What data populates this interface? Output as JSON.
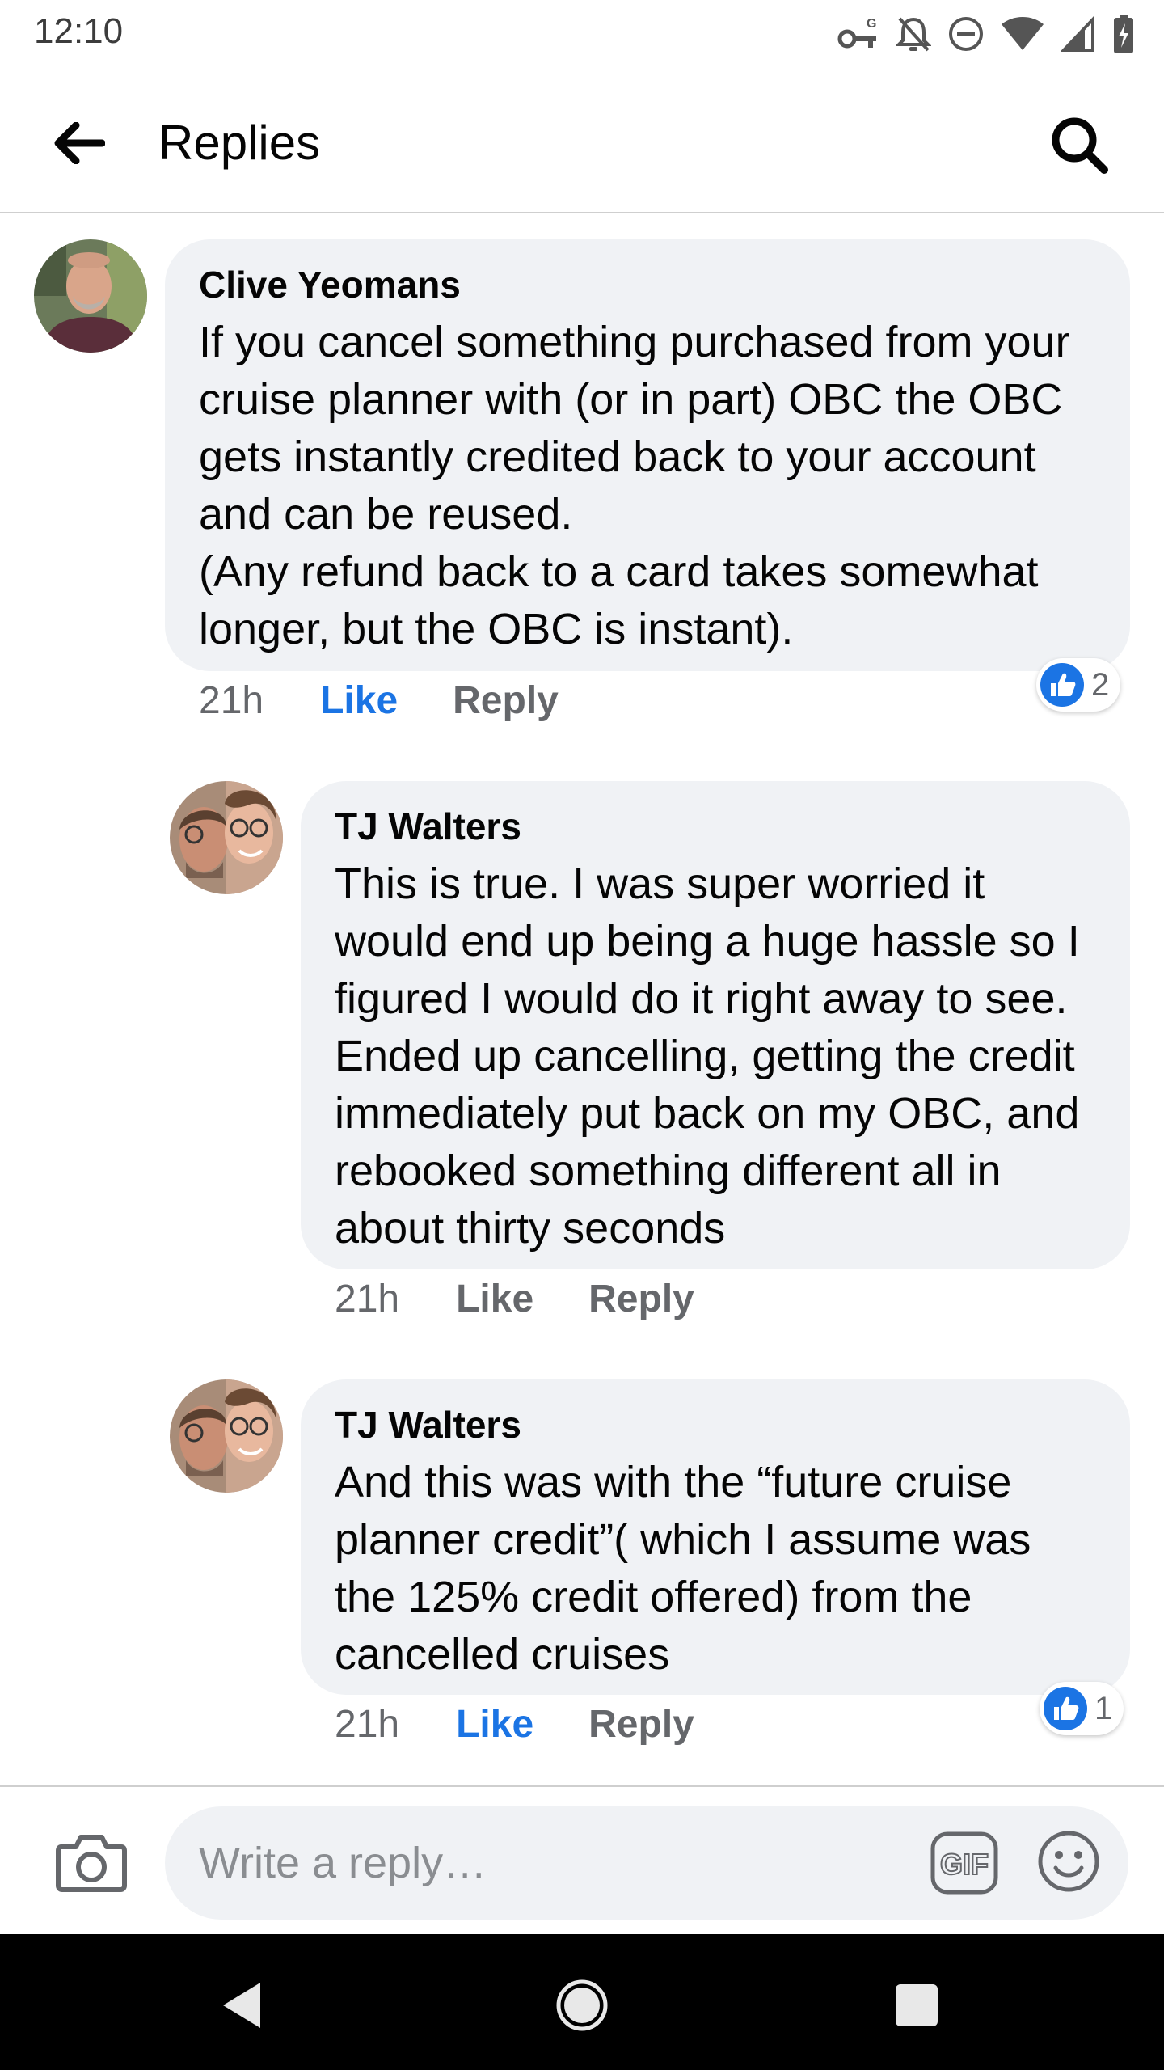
{
  "status_bar": {
    "time": "12:10"
  },
  "header": {
    "title": "Replies"
  },
  "comments": [
    {
      "author": "Clive Yeomans",
      "text": "If you cancel something purchased from your cruise planner with (or in part) OBC the OBC gets instantly credited back to your account and can be reused.\n(Any refund back to a card takes somewhat longer, but the OBC is instant).",
      "time": "21h",
      "like_label": "Like",
      "reply_label": "Reply",
      "liked": true,
      "reaction_count": "2"
    },
    {
      "author": "TJ Walters",
      "text": "This is true. I was super worried it would end up being a huge hassle so I figured I would do it right away to see. Ended up cancelling, getting the credit immediately put back on my OBC, and rebooked something different all in about thirty seconds",
      "time": "21h",
      "like_label": "Like",
      "reply_label": "Reply",
      "liked": false
    },
    {
      "author": "TJ Walters",
      "text": "And this was with the “future cruise planner credit”( which I assume was the 125% credit offered) from the cancelled cruises",
      "time": "21h",
      "like_label": "Like",
      "reply_label": "Reply",
      "liked": true,
      "reaction_count": "1"
    }
  ],
  "composer": {
    "placeholder": "Write a reply…",
    "gif_label": "GIF"
  },
  "colors": {
    "accent": "#1b74e4",
    "bubble": "#f0f2f5",
    "meta": "#65676b"
  },
  "icons": {
    "status": [
      "vpn-key-icon",
      "notifications-off-icon",
      "do-not-disturb-icon",
      "wifi-icon",
      "cell-signal-icon",
      "battery-charging-icon"
    ],
    "header": [
      "back-arrow-icon",
      "search-icon"
    ],
    "composer": [
      "camera-icon",
      "gif-icon",
      "emoji-icon"
    ],
    "nav": [
      "nav-back-icon",
      "nav-home-icon",
      "nav-recents-icon"
    ]
  }
}
